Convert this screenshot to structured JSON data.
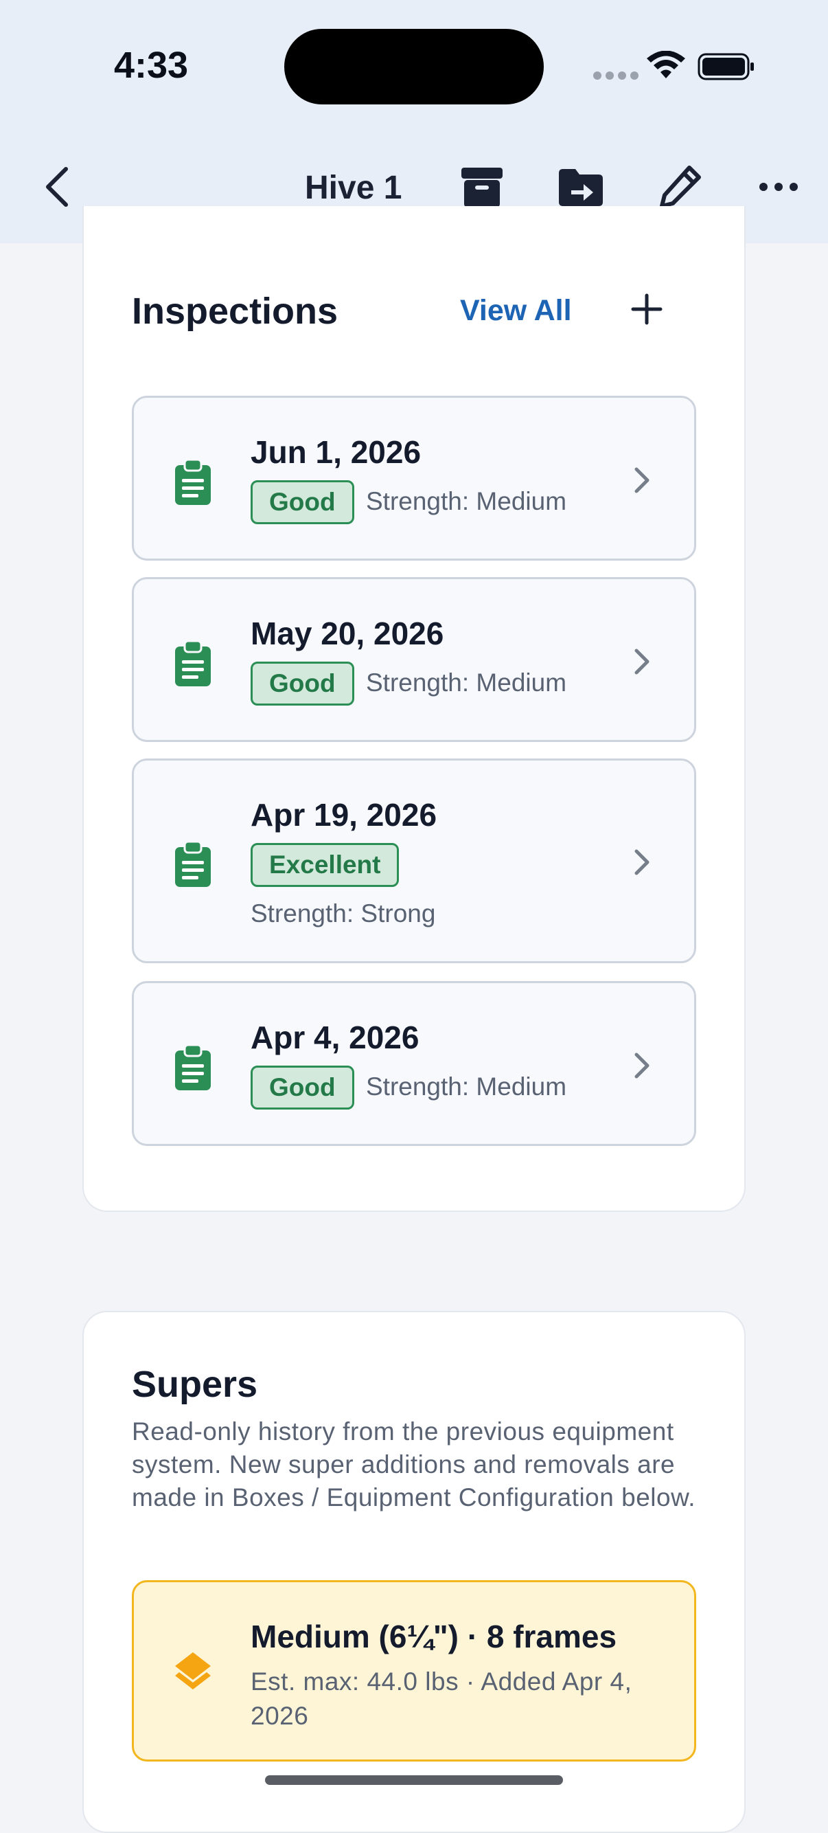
{
  "status": {
    "time": "4:33"
  },
  "nav": {
    "title": "Hive 1"
  },
  "inspections": {
    "title": "Inspections",
    "view_all_label": "View All",
    "items": [
      {
        "date": "Jun 1, 2026",
        "rating": "Good",
        "strength": "Strength: Medium"
      },
      {
        "date": "May 20, 2026",
        "rating": "Good",
        "strength": "Strength: Medium"
      },
      {
        "date": "Apr 19, 2026",
        "rating": "Excellent",
        "strength": "Strength: Strong"
      },
      {
        "date": "Apr 4, 2026",
        "rating": "Good",
        "strength": "Strength: Medium"
      }
    ]
  },
  "supers": {
    "title": "Supers",
    "description": "Read-only history from the previous equipment system. New super additions and removals are made in Boxes / Equipment Configuration below.",
    "items": [
      {
        "title": "Medium (6¼\") · 8 frames",
        "meta": "Est. max: 44.0 lbs  ·  Added Apr 4, 2026"
      }
    ]
  },
  "icons": {
    "back": "chevron-left-icon",
    "archive": "archive-icon",
    "move": "folder-move-icon",
    "edit": "pencil-icon",
    "more": "more-horizontal-icon",
    "add": "plus-icon",
    "inspection": "clipboard-icon",
    "chevron": "chevron-right-icon",
    "super": "layers-icon"
  },
  "colors": {
    "accent": "#1e64b4",
    "good": "#2b8f55",
    "super_border": "#f2b61e",
    "super_icon": "#f5a512"
  }
}
